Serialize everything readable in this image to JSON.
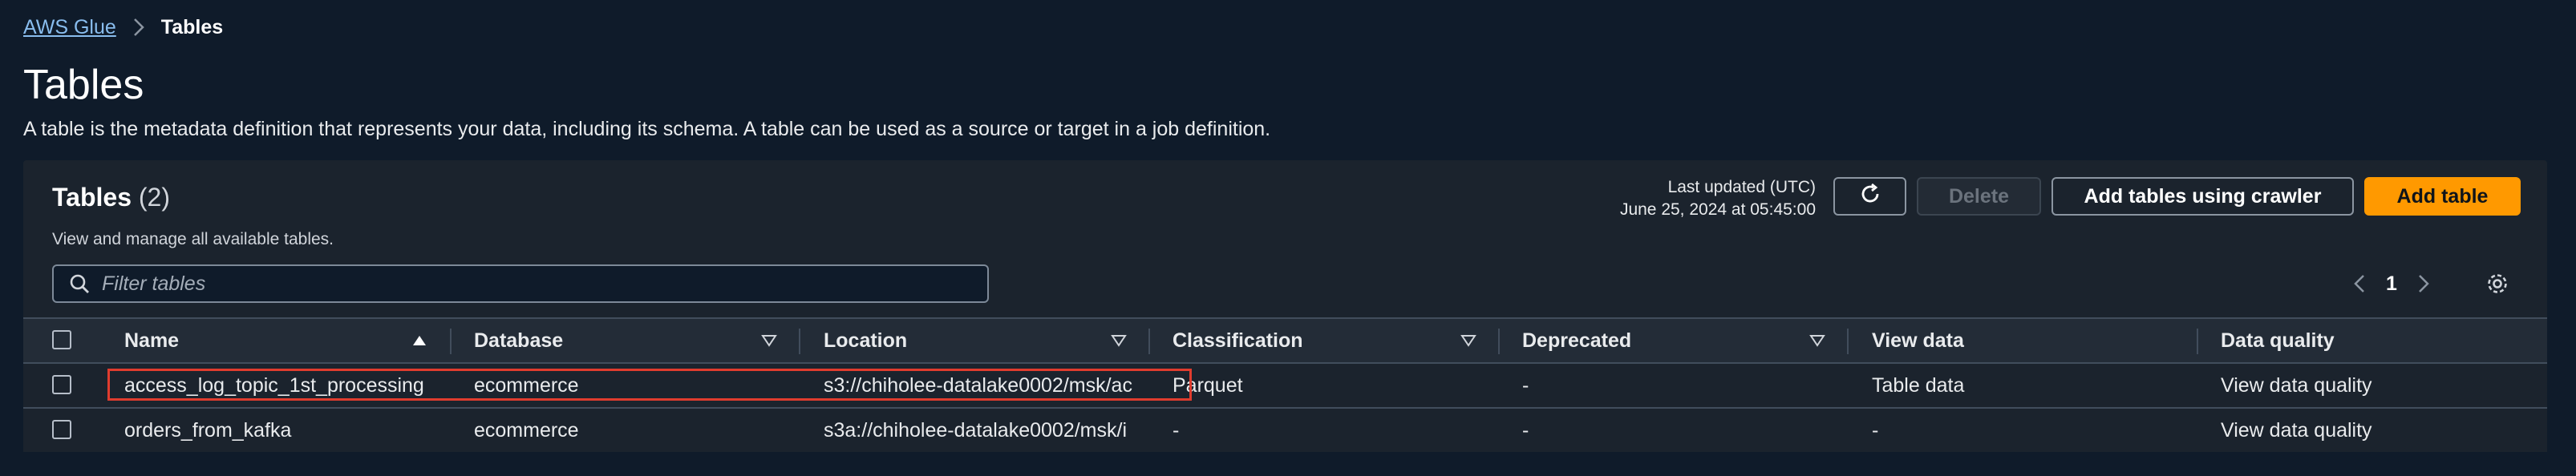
{
  "breadcrumb": {
    "root": "AWS Glue",
    "current": "Tables"
  },
  "page": {
    "title": "Tables",
    "description": "A table is the metadata definition that represents your data, including its schema. A table can be used as a source or target in a job definition."
  },
  "panel": {
    "title": "Tables",
    "count": "(2)",
    "subtitle": "View and manage all available tables.",
    "last_updated_label": "Last updated (UTC)",
    "last_updated_value": "June 25, 2024 at 05:45:00",
    "buttons": {
      "delete": "Delete",
      "add_crawler": "Add tables using crawler",
      "add_table": "Add table"
    },
    "filter_placeholder": "Filter tables",
    "page_number": "1"
  },
  "columns": [
    "Name",
    "Database",
    "Location",
    "Classification",
    "Deprecated",
    "View data",
    "Data quality"
  ],
  "rows": [
    {
      "name": "access_log_topic_1st_processing",
      "database": "ecommerce",
      "location": "s3://chiholee-datalake0002/msk/ac",
      "classification": "Parquet",
      "deprecated": "-",
      "view_data": "Table data",
      "data_quality": "View data quality"
    },
    {
      "name": "orders_from_kafka",
      "database": "ecommerce",
      "location": "s3a://chiholee-datalake0002/msk/i",
      "classification": "-",
      "deprecated": "-",
      "view_data": "-",
      "data_quality": "View data quality"
    }
  ],
  "colors": {
    "accent": "#ff9900",
    "link": "#89bdee",
    "highlight": "#e03c2e",
    "background": "#0f1b2a",
    "panel": "#1b232d"
  }
}
